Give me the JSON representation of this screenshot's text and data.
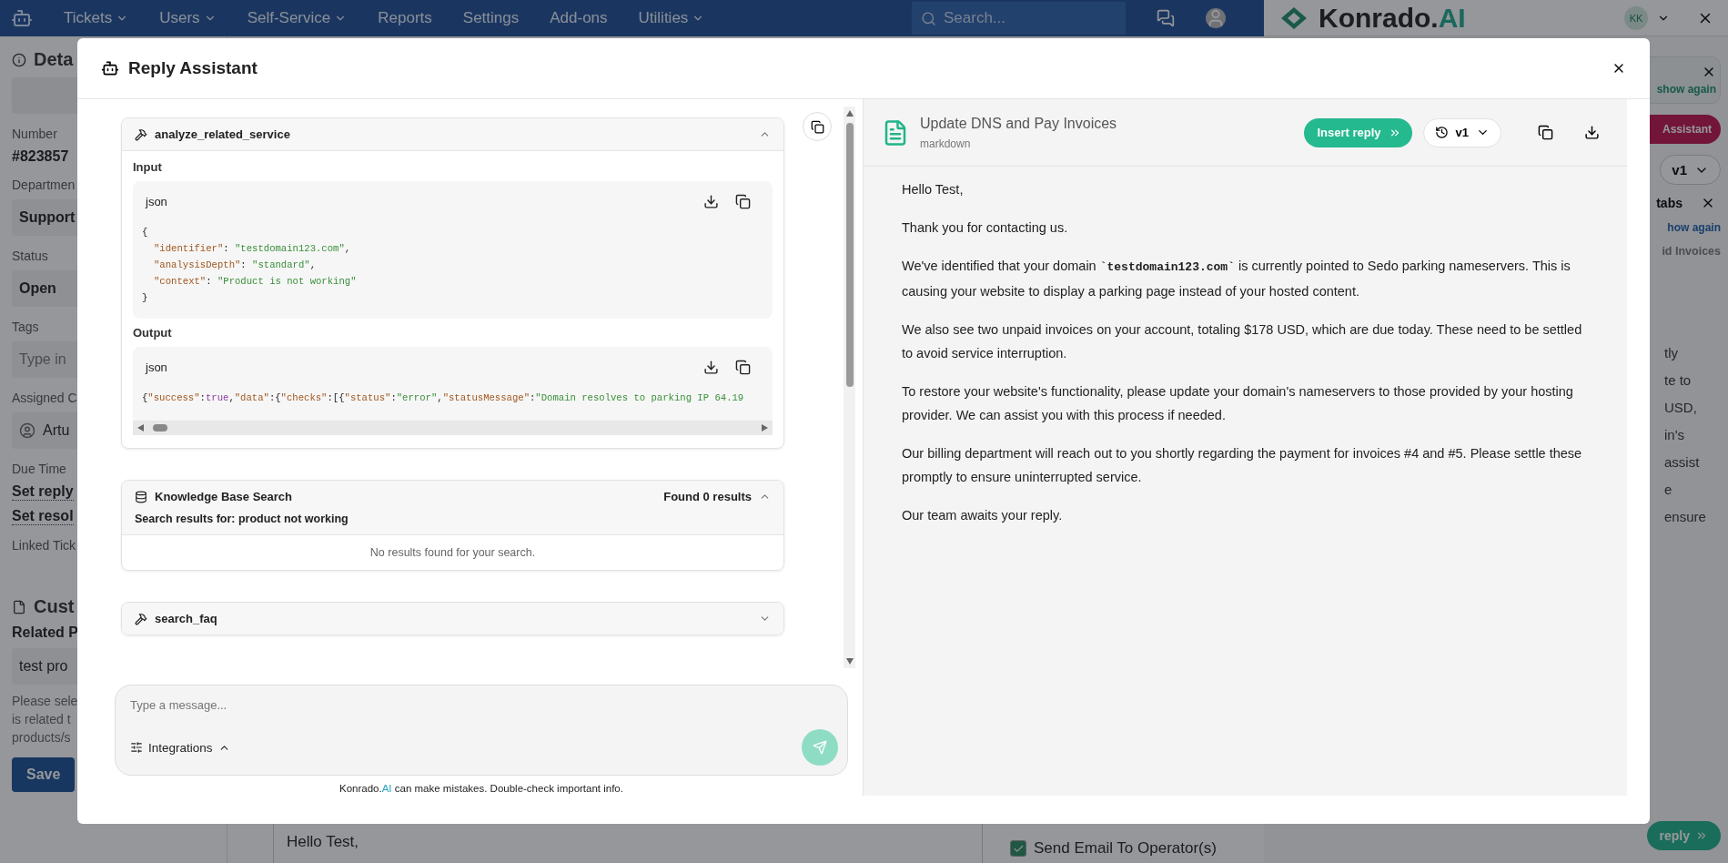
{
  "nav": {
    "items": [
      {
        "label": "Tickets",
        "dropdown": true
      },
      {
        "label": "Users",
        "dropdown": true
      },
      {
        "label": "Self-Service",
        "dropdown": true
      },
      {
        "label": "Reports",
        "dropdown": false
      },
      {
        "label": "Settings",
        "dropdown": false
      },
      {
        "label": "Add-ons",
        "dropdown": false
      },
      {
        "label": "Utilities",
        "dropdown": true
      }
    ],
    "search": {
      "placeholder": "Search..."
    }
  },
  "assistant_panel": {
    "brand": "Konrado.",
    "brand_accent": "AI",
    "avatar": "KK",
    "notice_link": "show again",
    "assistant_button": "Assistant",
    "version": "v1",
    "tabs_notice": "tabs",
    "tabs_link": "how again",
    "tab": "id Invoices",
    "reply_fragments": [
      "tly",
      "te to",
      "USD,",
      "in's",
      "assist",
      "e",
      "ensure"
    ],
    "reply_button": "reply"
  },
  "details": {
    "title": "Deta",
    "fields": [
      {
        "kind": "text",
        "label": "Number",
        "value": "#823857"
      },
      {
        "kind": "select",
        "label": "Departmen",
        "value": "Support"
      },
      {
        "kind": "select",
        "label": "Status",
        "value": "Open"
      },
      {
        "kind": "input",
        "label": "Tags",
        "placeholder": "Type in"
      },
      {
        "kind": "user",
        "label": "Assigned C",
        "value": "Artu"
      },
      {
        "kind": "links",
        "label": "Due Time",
        "links": [
          "Set reply",
          "Set resol"
        ]
      },
      {
        "kind": "label",
        "label": "Linked Tick"
      }
    ],
    "custom_title": "Cust",
    "related_label": "Related P",
    "related_value": "test pro",
    "help_lines": [
      "Please sele",
      "is related t",
      "products/s"
    ],
    "save": "Save"
  },
  "editor": {
    "text": "Hello Test,"
  },
  "send_email": {
    "label": "Send Email To Operator(s)",
    "checked": true
  },
  "modal": {
    "title": "Reply Assistant",
    "tool_cards": [
      {
        "kind": "tool",
        "name": "analyze_related_service",
        "expanded": true,
        "sections": [
          {
            "kind": "wrapped",
            "label": "Input",
            "lang": "json",
            "lines": [
              {
                "indented": false,
                "tokens": [
                  {
                    "kind": "punct",
                    "text": "{"
                  }
                ]
              },
              {
                "indented": true,
                "tokens": [
                  {
                    "kind": "key",
                    "text": "\"identifier\""
                  },
                  {
                    "kind": "punct",
                    "text": ": "
                  },
                  {
                    "kind": "str",
                    "text": "\"testdomain123.com\""
                  },
                  {
                    "kind": "punct",
                    "text": ","
                  }
                ]
              },
              {
                "indented": true,
                "tokens": [
                  {
                    "kind": "key",
                    "text": "\"analysisDepth\""
                  },
                  {
                    "kind": "punct",
                    "text": ": "
                  },
                  {
                    "kind": "str",
                    "text": "\"standard\""
                  },
                  {
                    "kind": "punct",
                    "text": ","
                  }
                ]
              },
              {
                "indented": true,
                "tokens": [
                  {
                    "kind": "key",
                    "text": "\"context\""
                  },
                  {
                    "kind": "punct",
                    "text": ": "
                  },
                  {
                    "kind": "str",
                    "text": "\"Product is not working\""
                  }
                ]
              },
              {
                "indented": false,
                "tokens": [
                  {
                    "kind": "punct",
                    "text": "}"
                  }
                ]
              }
            ]
          },
          {
            "kind": "scrolling",
            "label": "Output",
            "lang": "json",
            "lines": [
              {
                "indented": false,
                "tokens": [
                  {
                    "kind": "punct",
                    "text": "{"
                  },
                  {
                    "kind": "key",
                    "text": "\"success\""
                  },
                  {
                    "kind": "punct",
                    "text": ":"
                  },
                  {
                    "kind": "bool",
                    "text": "true"
                  },
                  {
                    "kind": "punct",
                    "text": ","
                  },
                  {
                    "kind": "key",
                    "text": "\"data\""
                  },
                  {
                    "kind": "punct",
                    "text": ":{"
                  },
                  {
                    "kind": "key",
                    "text": "\"checks\""
                  },
                  {
                    "kind": "punct",
                    "text": ":[{"
                  },
                  {
                    "kind": "key",
                    "text": "\"status\""
                  },
                  {
                    "kind": "punct",
                    "text": ":"
                  },
                  {
                    "kind": "str",
                    "text": "\"error\""
                  },
                  {
                    "kind": "punct",
                    "text": ","
                  },
                  {
                    "kind": "key",
                    "text": "\"statusMessage\""
                  },
                  {
                    "kind": "punct",
                    "text": ":"
                  },
                  {
                    "kind": "str",
                    "text": "\"Domain resolves to parking IP 64.19"
                  }
                ]
              }
            ]
          }
        ]
      },
      {
        "kind": "search",
        "name": "Knowledge Base Search",
        "summary": "Found 0 results",
        "expanded": true,
        "query": "Search results for: product not working",
        "empty": "No results found for your search."
      },
      {
        "kind": "tool",
        "name": "search_faq",
        "expanded": false
      }
    ],
    "composer": {
      "placeholder": "Type a message...",
      "integrations": "Integrations"
    },
    "disclaimer": {
      "brand": "Konrado.",
      "brand_accent": "AI",
      "text": " can make mistakes. Double-check important info."
    },
    "document": {
      "title": "Update DNS and Pay Invoices",
      "format": "markdown",
      "insert": "Insert reply",
      "version": "v1",
      "paragraphs": [
        [
          {
            "kind": "text",
            "text": "Hello Test,"
          }
        ],
        [
          {
            "kind": "text",
            "text": "Thank you for contacting us."
          }
        ],
        [
          {
            "kind": "text",
            "text": "We've identified that your domain "
          },
          {
            "kind": "code",
            "text": "`testdomain123.com`"
          },
          {
            "kind": "text",
            "text": " is currently pointed to Sedo parking nameservers. This is causing your website to display a parking page instead of your hosted content."
          }
        ],
        [
          {
            "kind": "text",
            "text": "We also see two unpaid invoices on your account, totaling $178 USD, which are due today. These need to be settled to avoid service interruption."
          }
        ],
        [
          {
            "kind": "text",
            "text": "To restore your website's functionality, please update your domain's nameservers to those provided by your hosting provider. We can assist you with this process if needed."
          }
        ],
        [
          {
            "kind": "text",
            "text": "Our billing department will reach out to you shortly regarding the payment for invoices #4 and #5. Please settle these promptly to ensure uninterrupted service."
          }
        ],
        [
          {
            "kind": "text",
            "text": "Our team awaits your reply."
          }
        ]
      ]
    }
  }
}
